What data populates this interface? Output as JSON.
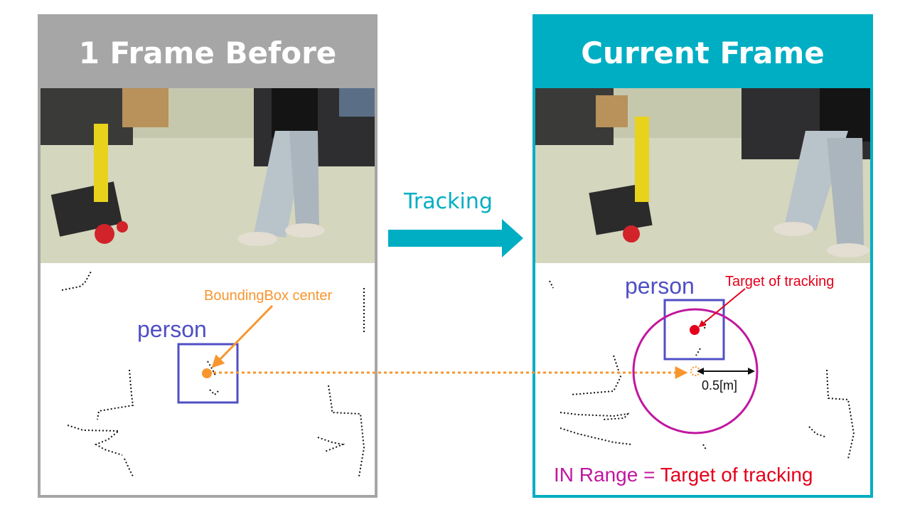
{
  "left_panel": {
    "title": "1 Frame Before",
    "person_label": "person",
    "bbox_center_label": "BoundingBox center"
  },
  "right_panel": {
    "title": "Current Frame",
    "person_label": "person",
    "target_label": "Target of tracking",
    "distance_label": "0.5[m]",
    "range_prefix": "IN Range",
    "range_equals": " = ",
    "range_target": "Target of tracking"
  },
  "middle": {
    "tracking_label": "Tracking"
  },
  "colors": {
    "gray_header": "#a6a6a6",
    "teal_header": "#00aec3",
    "person_box": "#4f4fc4",
    "orange": "#f7962f",
    "red_target": "#e4001b",
    "magenta_range": "#c0179f"
  }
}
